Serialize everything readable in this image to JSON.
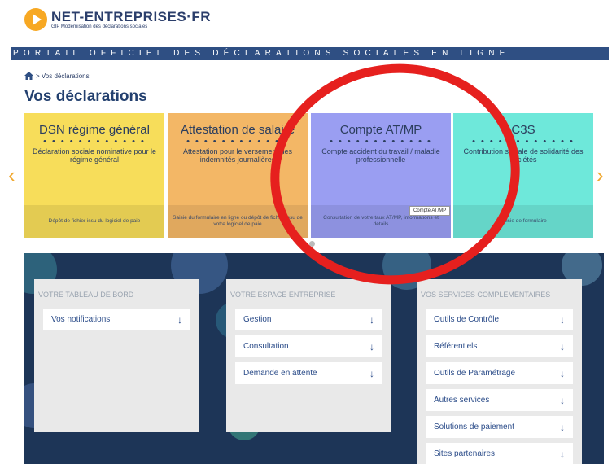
{
  "header": {
    "logo_name": "NET-ENTREPRISES·FR",
    "logo_sub": "GIP Modernisation des déclarations sociales",
    "banner": "PORTAIL OFFICIEL DES DÉCLARATIONS SOCIALES EN LIGNE"
  },
  "breadcrumb": {
    "text": "> Vos déclarations"
  },
  "page_title": "Vos déclarations",
  "carousel": {
    "tiles": [
      {
        "title": "DSN régime général",
        "dots": "• • • • • • • • • • • •",
        "desc": "Déclaration sociale nominative pour le régime général",
        "footer": "Dépôt de fichier issu du logiciel de paie",
        "color": "#f7dd5a"
      },
      {
        "title": "Attestation de salaire",
        "dots": "• • • • • • • • • • • •",
        "desc": "Attestation pour le versement des indemnités journalières",
        "footer": "Saisie du formulaire en ligne ou dépôt de fichier issu de votre logiciel de paie",
        "color": "#f3b766"
      },
      {
        "title": "Compte AT/MP",
        "dots": "• • • • • • • • • • • •",
        "desc": "Compte accident du travail / maladie professionnelle",
        "footer": "Consultation de votre taux AT/MP, informations et détails",
        "color": "#9a9ef2"
      },
      {
        "title": "C3S",
        "dots": "• • • • • • • • • • • •",
        "desc": "Contribution sociale de solidarité des sociétés",
        "footer": "Saisie de formulaire",
        "color": "#6ee8da"
      }
    ],
    "tooltip": "Compte AT/MP"
  },
  "dashboard": {
    "panels": [
      {
        "title": "VOTRE TABLEAU DE BORD",
        "items": [
          "Vos notifications"
        ]
      },
      {
        "title": "VOTRE ESPACE ENTREPRISE",
        "items": [
          "Gestion",
          "Consultation",
          "Demande en attente"
        ]
      },
      {
        "title": "VOS SERVICES COMPLEMENTAIRES",
        "items": [
          "Outils de Contrôle",
          "Référentiels",
          "Outils de Paramétrage",
          "Autres services",
          "Solutions de paiement",
          "Sites partenaires"
        ]
      }
    ],
    "down_arrow": "↓"
  },
  "colors": {
    "brand_orange": "#f7a823",
    "navy": "#2f4f83",
    "annotation_red": "#e6201e"
  },
  "icons": {
    "home": "home-icon",
    "prev": "chevron-left-icon",
    "next": "chevron-right-icon",
    "down": "arrow-down-icon"
  }
}
